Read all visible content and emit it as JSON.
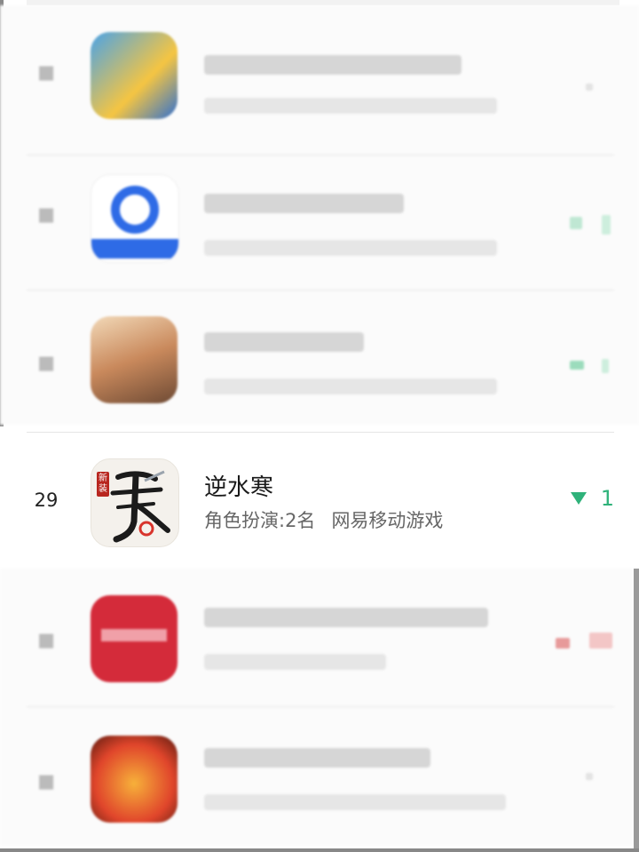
{
  "ranking": {
    "featured": {
      "rank": "29",
      "title": "逆水寒",
      "category_rank": "角色扮演:2名",
      "developer": "网易移动游戏",
      "change": "1",
      "change_direction": "down",
      "change_color": "#2fb27a",
      "icon": "nishuihan-app-icon",
      "icon_badge": "新装",
      "icon_glyph": "寒"
    },
    "colors": {
      "background": "#ffffff",
      "divider": "#e6e6e6",
      "rank_text": "#222222",
      "title_text": "#1a1a1a",
      "subtitle_text": "#666666",
      "positive": "#2fb27a",
      "negative": "#e05050"
    }
  }
}
